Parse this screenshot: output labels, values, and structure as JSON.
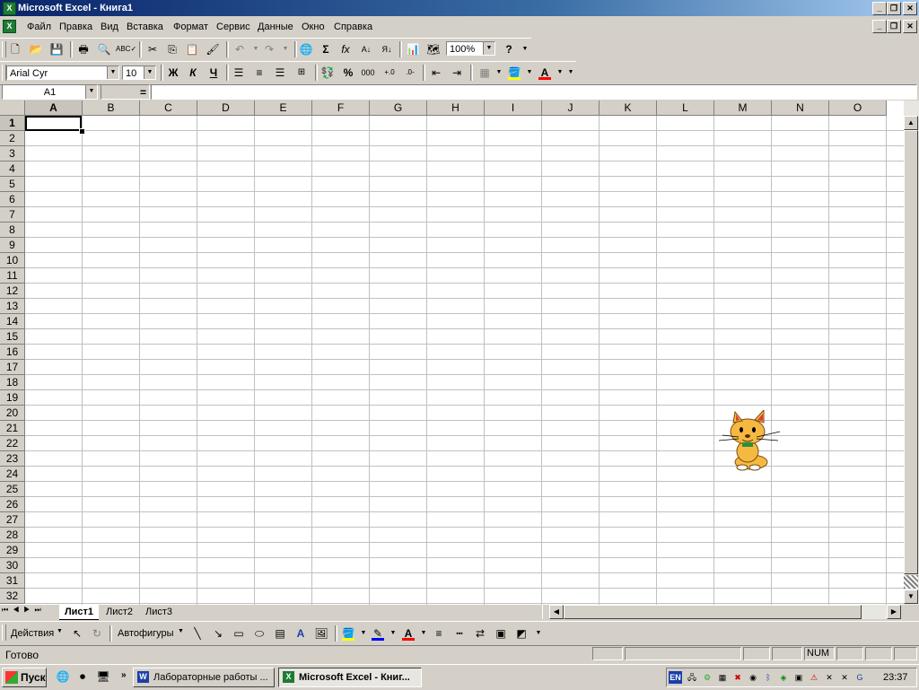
{
  "window": {
    "title": "Microsoft Excel - Книга1"
  },
  "menu": [
    "Файл",
    "Правка",
    "Вид",
    "Вставка",
    "Формат",
    "Сервис",
    "Данные",
    "Окно",
    "Справка"
  ],
  "standard_toolbar": {
    "zoom": "100%"
  },
  "format_toolbar": {
    "font": "Arial Cyr",
    "size": "10",
    "bold": "Ж",
    "italic": "К",
    "underline": "Ч",
    "percent": "%",
    "thousands": "000"
  },
  "formula_bar": {
    "name_box": "A1",
    "equals": "="
  },
  "grid": {
    "columns": [
      "A",
      "B",
      "C",
      "D",
      "E",
      "F",
      "G",
      "H",
      "I",
      "J",
      "K",
      "L",
      "M",
      "N",
      "O"
    ],
    "rows": [
      "1",
      "2",
      "3",
      "4",
      "5",
      "6",
      "7",
      "8",
      "9",
      "10",
      "11",
      "12",
      "13",
      "14",
      "15",
      "16",
      "17",
      "18",
      "19",
      "20",
      "21",
      "22",
      "23",
      "24",
      "25",
      "26",
      "27",
      "28",
      "29",
      "30",
      "31",
      "32"
    ],
    "active_cell": "A1"
  },
  "sheets": [
    "Лист1",
    "Лист2",
    "Лист3"
  ],
  "drawing_toolbar": {
    "actions": "Действия",
    "autoshapes": "Автофигуры"
  },
  "status": {
    "ready": "Готово",
    "num": "NUM"
  },
  "taskbar": {
    "start": "Пуск",
    "tasks": [
      "Лабораторные работы ...",
      "Microsoft Excel - Книг..."
    ],
    "lang": "EN",
    "clock": "23:37"
  },
  "colors": {
    "title_start": "#0a246a",
    "title_end": "#a6caf0",
    "fill_yellow": "#ffff00",
    "font_red": "#ff0000",
    "excel_green": "#1e7b34"
  }
}
